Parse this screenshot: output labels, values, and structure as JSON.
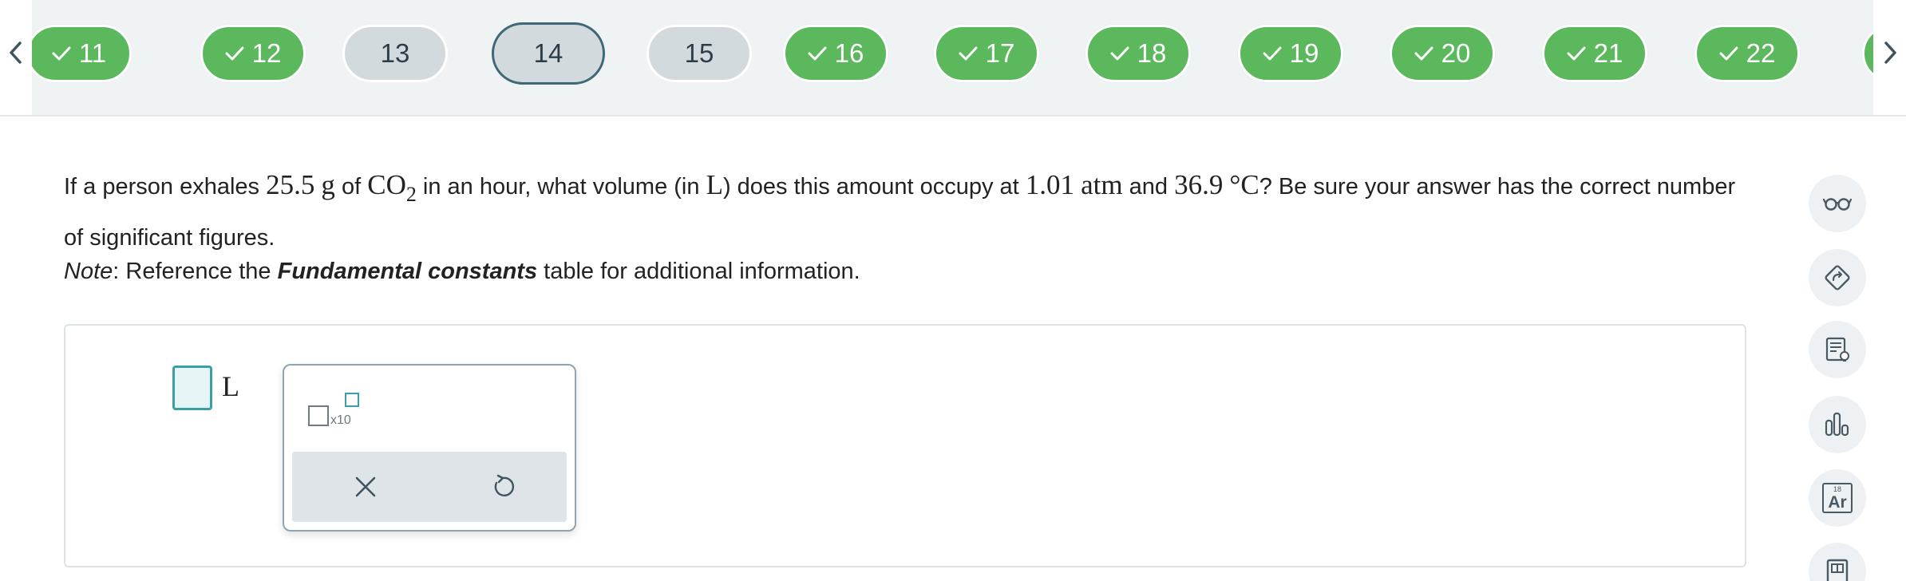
{
  "nav": {
    "questions": [
      {
        "label": "11",
        "state": "done"
      },
      {
        "label": "12",
        "state": "done"
      },
      {
        "label": "13",
        "state": "todo"
      },
      {
        "label": "14",
        "state": "current"
      },
      {
        "label": "15",
        "state": "todo"
      },
      {
        "label": "16",
        "state": "done"
      },
      {
        "label": "17",
        "state": "done"
      },
      {
        "label": "18",
        "state": "done"
      },
      {
        "label": "19",
        "state": "done"
      },
      {
        "label": "20",
        "state": "done"
      },
      {
        "label": "21",
        "state": "done"
      },
      {
        "label": "22",
        "state": "done"
      }
    ],
    "partial_next": {
      "state": "done"
    },
    "prev_icon": "chevron-left-icon",
    "next_icon": "chevron-right-icon",
    "done_color": "#5cb85c",
    "todo_color": "#d3dade",
    "current_border_color": "#3e6778"
  },
  "question": {
    "t1": "If a person exhales ",
    "mass": "25.5",
    "mass_unit": "g",
    "t2": " of ",
    "formula": "CO",
    "formula_sub": "2",
    "t3": " in an hour, what volume (in ",
    "vol_unit": "L",
    "t4": ") does this amount occupy at ",
    "pressure": "1.01",
    "pressure_unit": "atm",
    "t5": " and ",
    "temp": "36.9",
    "temp_unit": "°C",
    "t6": "? Be sure your answer has the correct number of significant figures."
  },
  "note": {
    "label": "Note",
    "t1": ": Reference the ",
    "table_name": "Fundamental constants",
    "t2": " table for additional information."
  },
  "answer": {
    "value": "",
    "unit": "L",
    "accent_color": "#3aa0a8"
  },
  "palette": {
    "sci_label": "x10",
    "sci_icon": "scientific-notation-icon",
    "clear_icon": "close-icon",
    "undo_icon": "undo-icon"
  },
  "tools": [
    {
      "name": "explanation-glasses-icon"
    },
    {
      "name": "tag-arrow-icon"
    },
    {
      "name": "notes-lightbulb-icon"
    },
    {
      "name": "bar-chart-icon"
    },
    {
      "name": "periodic-table-icon",
      "number": "18",
      "symbol": "Ar"
    },
    {
      "name": "book-icon"
    }
  ]
}
